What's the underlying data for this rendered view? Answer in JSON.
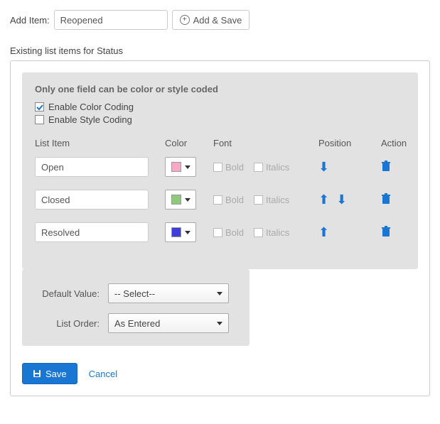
{
  "add_item": {
    "label": "Add Item:",
    "value": "Reopened",
    "button": "Add & Save"
  },
  "section_title": "Existing list items for Status",
  "panel": {
    "title": "Only one field can be color or style coded",
    "enable_color": {
      "label": "Enable Color Coding",
      "checked": true
    },
    "enable_style": {
      "label": "Enable Style Coding",
      "checked": false
    },
    "headers": {
      "list_item": "List Item",
      "color": "Color",
      "font": "Font",
      "position": "Position",
      "action": "Action"
    },
    "font_labels": {
      "bold": "Bold",
      "italics": "Italics"
    },
    "items": [
      {
        "name": "Open",
        "color": "#f8a7c4",
        "up": false,
        "down": true
      },
      {
        "name": "Closed",
        "color": "#8fc97d",
        "up": true,
        "down": true
      },
      {
        "name": "Resolved",
        "color": "#3f3fd8",
        "up": true,
        "down": false
      }
    ]
  },
  "settings": {
    "default_value": {
      "label": "Default Value:",
      "selected": "-- Select--"
    },
    "list_order": {
      "label": "List Order:",
      "selected": "As Entered"
    }
  },
  "footer": {
    "save": "Save",
    "cancel": "Cancel"
  }
}
